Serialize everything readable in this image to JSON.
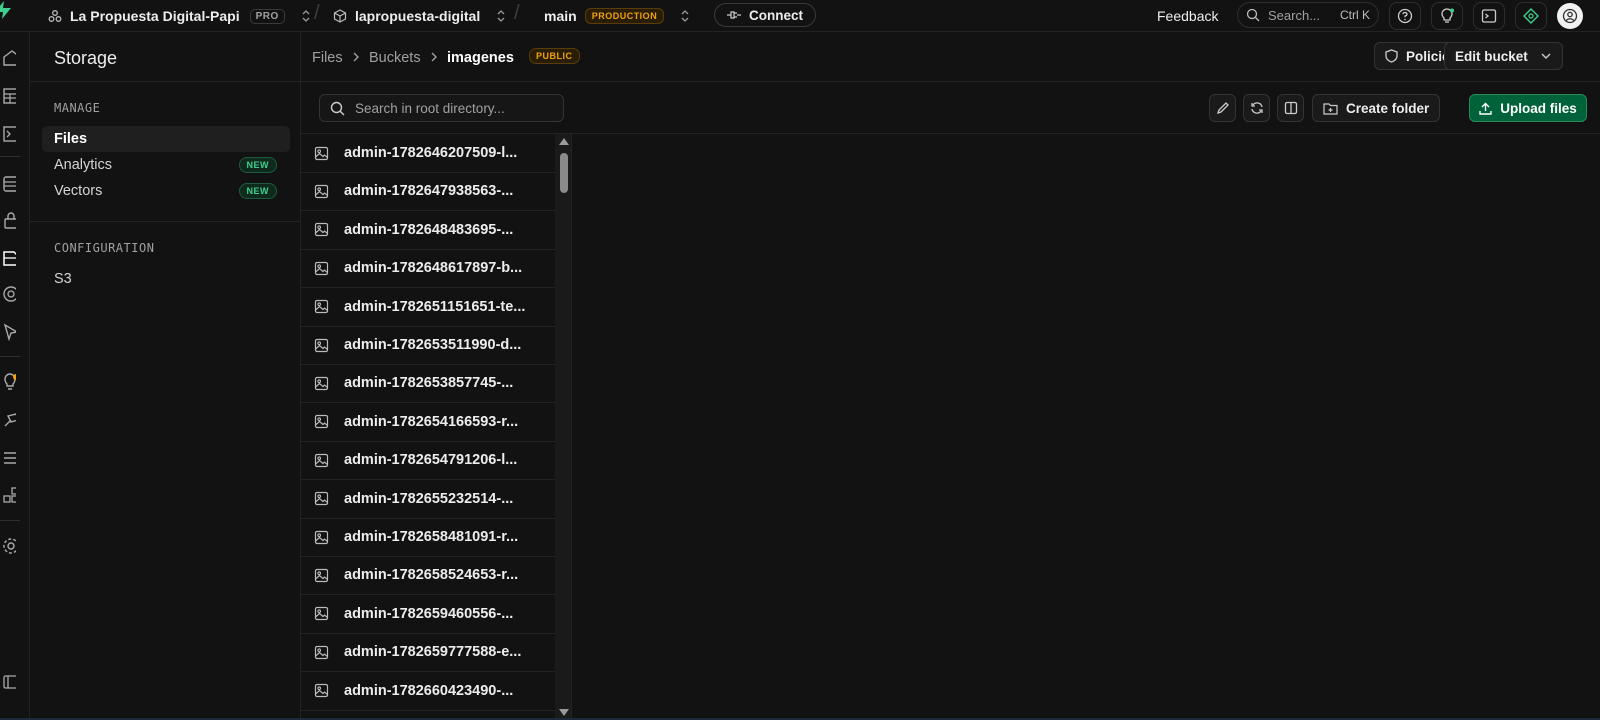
{
  "topbar": {
    "org_name": "La Propuesta Digital-Papi",
    "org_plan": "PRO",
    "project_name": "lapropuesta-digital",
    "branch_name": "main",
    "branch_env": "PRODUCTION",
    "connect_label": "Connect",
    "feedback_label": "Feedback",
    "search_placeholder": "Search...",
    "search_shortcut": "Ctrl K"
  },
  "sidebar": {
    "title": "Storage",
    "manage_label": "MANAGE",
    "manage_items": [
      {
        "label": "Files",
        "active": true
      },
      {
        "label": "Analytics",
        "badge": "NEW"
      },
      {
        "label": "Vectors",
        "badge": "NEW"
      }
    ],
    "config_label": "CONFIGURATION",
    "config_items": [
      {
        "label": "S3"
      }
    ]
  },
  "header": {
    "breadcrumb": [
      "Files",
      "Buckets",
      "imagenes"
    ],
    "bucket_badge": "PUBLIC",
    "policies_label": "Policies",
    "edit_bucket_label": "Edit bucket"
  },
  "toolbar": {
    "search_placeholder": "Search in root directory...",
    "create_folder_label": "Create folder",
    "upload_label": "Upload files"
  },
  "files": [
    "admin-1782646207509-l...",
    "admin-1782647938563-...",
    "admin-1782648483695-...",
    "admin-1782648617897-b...",
    "admin-1782651151651-te...",
    "admin-1782653511990-d...",
    "admin-1782653857745-...",
    "admin-1782654166593-r...",
    "admin-1782654791206-l...",
    "admin-1782655232514-...",
    "admin-1782658481091-r...",
    "admin-1782658524653-r...",
    "admin-1782659460556-...",
    "admin-1782659777588-e...",
    "admin-1782660423490-..."
  ],
  "colors": {
    "background": "#121212",
    "accent_green": "#3ecf8e",
    "upload_button": "#006239",
    "warning_badge": "#f1a10d"
  },
  "icons": {
    "org": "org-icon",
    "project": "cube-icon",
    "connect": "plug-icon",
    "file": "image-file-icon"
  }
}
